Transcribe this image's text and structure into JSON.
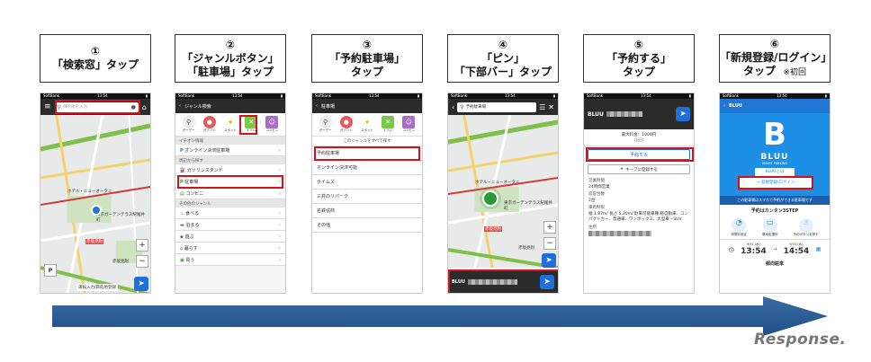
{
  "steps": [
    {
      "num": "①",
      "line1": "「検索窓」タップ",
      "line2": "",
      "note": ""
    },
    {
      "num": "②",
      "line1": "「ジャンルボタン」",
      "line2": "「駐車場」タップ",
      "note": ""
    },
    {
      "num": "③",
      "line1": "「予約駐車場」",
      "line2": "タップ",
      "note": ""
    },
    {
      "num": "④",
      "line1": "「ピン」",
      "line2": "「下部バー」タップ",
      "note": ""
    },
    {
      "num": "⑤",
      "line1": "「予約する」",
      "line2": "タップ",
      "note": ""
    },
    {
      "num": "⑥",
      "line1": "「新規登録/ログイン」",
      "line2": "タップ",
      "note": "※初回"
    }
  ],
  "status": {
    "carrier": "SoftBank",
    "time": "13:54"
  },
  "screen1": {
    "search_placeholder": "目的地を入力",
    "label_station": "赤坂見附",
    "label_hotel": "ホテル・ニューオータニ",
    "label_garden": "東京ガーデンテラス紀尾井町",
    "label_akasaka": "赤坂見附",
    "menu_label": "運転入力/目的地登録"
  },
  "screen2": {
    "title": "ジャンル検索",
    "icons": [
      "ガーデー",
      "ガソリン",
      "スポット",
      "トイレ",
      "コンビニ"
    ],
    "section1": "イチオシ情報",
    "item1": "オンライン決済駐車場",
    "section2": "周辺から探す",
    "items2": [
      "ガソリンスタンド",
      "駐車場",
      "コンビニ"
    ],
    "section3": "その他のジャンル",
    "items3": [
      "食べる",
      "泊まる",
      "遊ぶ",
      "暮らす",
      "買う"
    ]
  },
  "screen3": {
    "title": "駐車場",
    "icons": [
      "ガーデー",
      "ガソリン",
      "スポット",
      "トイレ",
      "コンビニ"
    ],
    "all_label": "このジャンルをすべて探す",
    "items": [
      "予約駐車場",
      "オンライン決済可能",
      "タイムズ",
      "三井のリパーク",
      "名鉄協商",
      "その他"
    ]
  },
  "screen4": {
    "search": "予約駐車場",
    "label_hotel": "ホテル・ニューオータニ",
    "label_garden": "東京ガーデンテラス紀尾井町",
    "label_station": "赤坂見附",
    "label_akasaka": "赤坂見附",
    "bar_title": "BLUU"
  },
  "screen5": {
    "title": "BLUU",
    "price_line": "最大料金：1000円",
    "price_sub": "(当日)",
    "reserve_btn": "予約する",
    "keep_btn": "キープに登録する",
    "hours_label": "営業時間",
    "hours_value": "24時間営業",
    "capacity_label": "収容台数",
    "capacity_value": "2台",
    "limit_label": "車両制限",
    "limit_value": "幅 1.87m/ 長さ 5.20m/ 駐車可能車種 軽自動車、コンパクトカー、普通車、ワンボックス、大型車・SUV",
    "address_label": "住所"
  },
  "screen6": {
    "header": "BLUU",
    "logo_letter": "B",
    "logo_name": "BLUU",
    "logo_sub": "SMART PARKING",
    "bluu_btn": "BLUUとは",
    "login_btn": "→ 新規登録/ログイン",
    "info_bar": "この駐車場はスマホで予約ができる駐車場です",
    "steps_title": "予約はカンタン3STEP",
    "step_labels": [
      "時間を指定",
      "車両を選択",
      "予約ボタンを押す"
    ],
    "date1": "9/31 (水)",
    "date2": "9/31 (水)",
    "time1": "13:54",
    "time2": "14:54",
    "footer_label": "郵向駐車"
  },
  "brand": "Response."
}
